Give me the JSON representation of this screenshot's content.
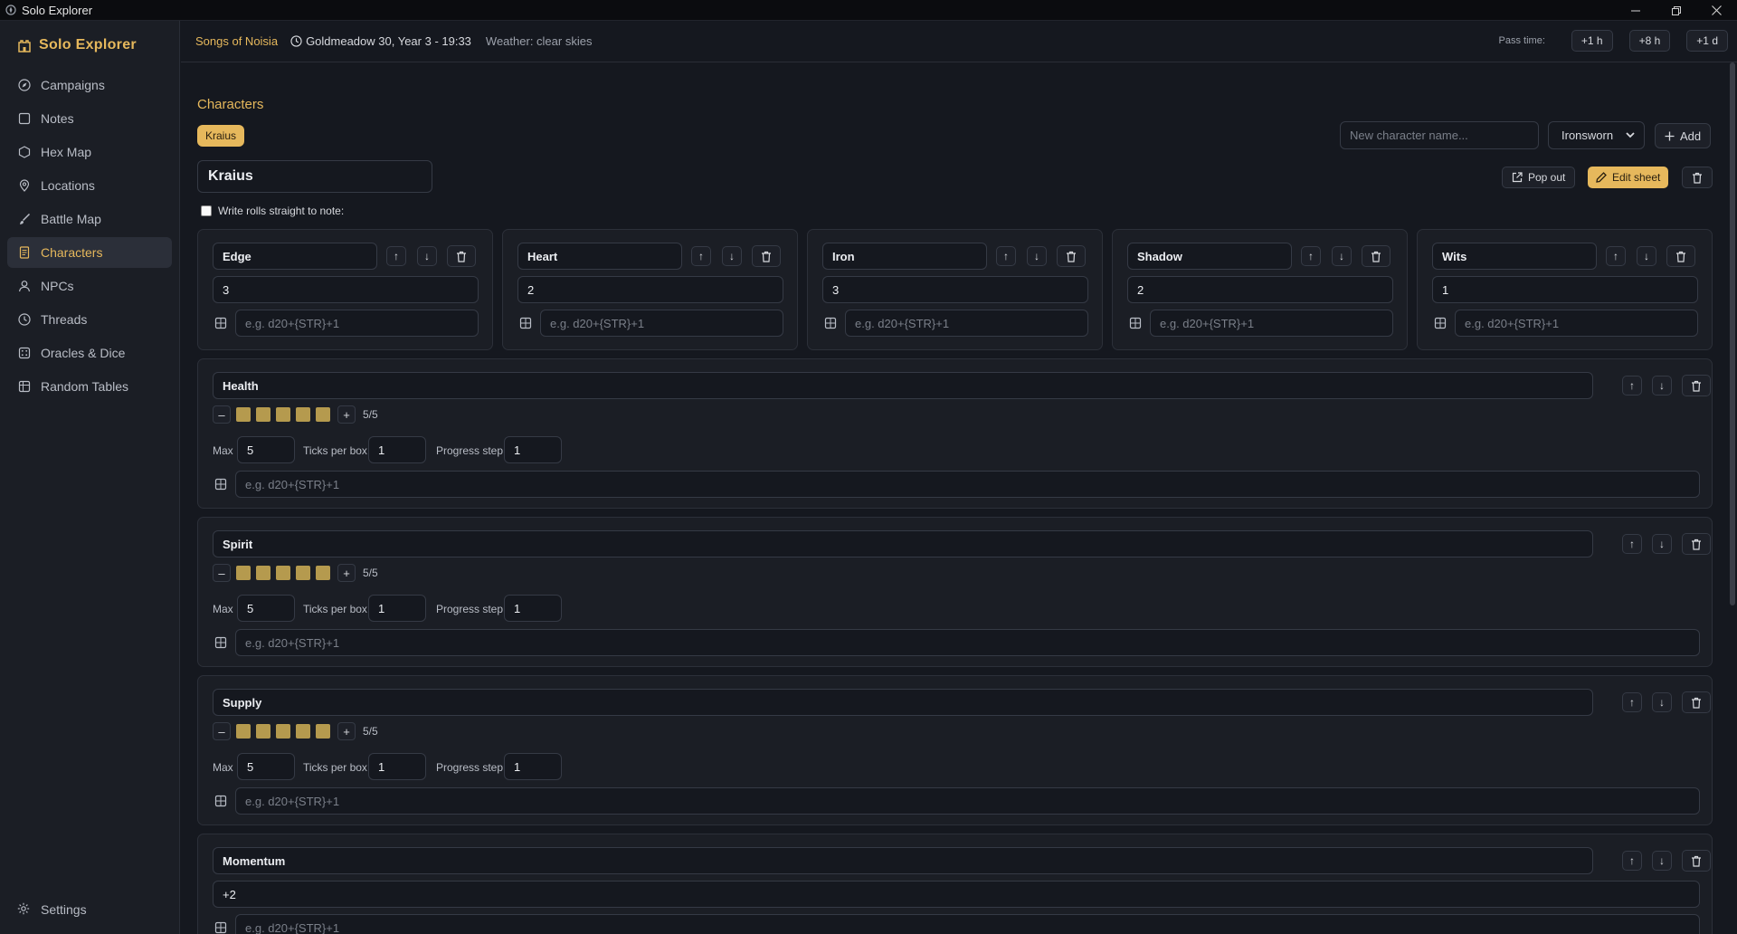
{
  "window": {
    "title": "Solo Explorer",
    "controls": [
      "minimize",
      "restore",
      "close"
    ]
  },
  "sidebar": {
    "brand": "Solo Explorer",
    "items": [
      {
        "label": "Campaigns",
        "icon": "compass-icon"
      },
      {
        "label": "Notes",
        "icon": "note-icon"
      },
      {
        "label": "Hex Map",
        "icon": "hexagon-icon"
      },
      {
        "label": "Locations",
        "icon": "map-pin-icon"
      },
      {
        "label": "Battle Map",
        "icon": "brush-icon"
      },
      {
        "label": "Characters",
        "icon": "sheet-icon",
        "active": true
      },
      {
        "label": "NPCs",
        "icon": "person-icon"
      },
      {
        "label": "Threads",
        "icon": "clock-icon"
      },
      {
        "label": "Oracles & Dice",
        "icon": "dice-icon"
      },
      {
        "label": "Random Tables",
        "icon": "table-icon"
      }
    ],
    "settings": "Settings"
  },
  "topbar": {
    "campaign": "Songs of Noisia",
    "datetime": "Goldmeadow 30, Year 3 - 19:33",
    "weather": "Weather: clear skies",
    "pass_time_label": "Pass time:",
    "pass_buttons": [
      "+1 h",
      "+8 h",
      "+1 d"
    ]
  },
  "characters": {
    "title": "Characters",
    "tabs": [
      "Kraius"
    ],
    "new_name_placeholder": "New character name...",
    "system": "Ironsworn",
    "add_label": "Add",
    "name": "Kraius",
    "pop_out_label": "Pop out",
    "edit_sheet_label": "Edit sheet",
    "write_rolls_label": "Write rolls straight to note:",
    "write_rolls_checked": false,
    "roll_placeholder": "e.g. d20+{STR}+1",
    "stats": [
      {
        "name": "Edge",
        "value": "3"
      },
      {
        "name": "Heart",
        "value": "2"
      },
      {
        "name": "Iron",
        "value": "3"
      },
      {
        "name": "Shadow",
        "value": "2"
      },
      {
        "name": "Wits",
        "value": "1"
      }
    ],
    "tracks": [
      {
        "name": "Health",
        "filled": 5,
        "max": 5,
        "count_text": "5/5",
        "max_label": "Max",
        "max_value": "5",
        "ticks_label": "Ticks per box",
        "ticks_value": "1",
        "step_label": "Progress step",
        "step_value": "1"
      },
      {
        "name": "Spirit",
        "filled": 5,
        "max": 5,
        "count_text": "5/5",
        "max_label": "Max",
        "max_value": "5",
        "ticks_label": "Ticks per box",
        "ticks_value": "1",
        "step_label": "Progress step",
        "step_value": "1"
      },
      {
        "name": "Supply",
        "filled": 5,
        "max": 5,
        "count_text": "5/5",
        "max_label": "Max",
        "max_value": "5",
        "ticks_label": "Ticks per box",
        "ticks_value": "1",
        "step_label": "Progress step",
        "step_value": "1"
      }
    ],
    "momentum": {
      "name": "Momentum",
      "value": "+2"
    },
    "buttons": {
      "up": "↑",
      "down": "↓",
      "minus": "–",
      "plus": "+"
    }
  }
}
